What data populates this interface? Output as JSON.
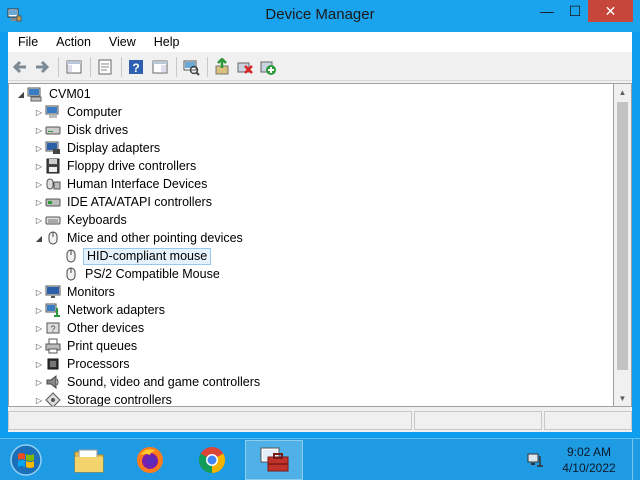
{
  "window": {
    "title": "Device Manager",
    "controls": {
      "minimize": "—",
      "maximize": "☐",
      "close": "✕"
    }
  },
  "menu": [
    "File",
    "Action",
    "View",
    "Help"
  ],
  "toolbar_icons": [
    "back-arrow-icon",
    "forward-arrow-icon",
    "console-tree-icon",
    "properties-icon",
    "help-icon",
    "action-pane-icon",
    "scan-hardware-icon",
    "update-driver-icon",
    "uninstall-device-icon",
    "enable-device-icon"
  ],
  "tree": {
    "root": "CVM01",
    "items": [
      {
        "label": "Computer",
        "icon": "computer-icon",
        "expanded": false
      },
      {
        "label": "Disk drives",
        "icon": "disk-drive-icon",
        "expanded": false
      },
      {
        "label": "Display adapters",
        "icon": "display-adapter-icon",
        "expanded": false
      },
      {
        "label": "Floppy drive controllers",
        "icon": "floppy-controller-icon",
        "expanded": false
      },
      {
        "label": "Human Interface Devices",
        "icon": "hid-icon",
        "expanded": false
      },
      {
        "label": "IDE ATA/ATAPI controllers",
        "icon": "ide-controller-icon",
        "expanded": false
      },
      {
        "label": "Keyboards",
        "icon": "keyboard-icon",
        "expanded": false
      },
      {
        "label": "Mice and other pointing devices",
        "icon": "mouse-icon",
        "expanded": true,
        "children": [
          {
            "label": "HID-compliant mouse",
            "icon": "mouse-icon",
            "selected": true
          },
          {
            "label": "PS/2 Compatible Mouse",
            "icon": "mouse-icon",
            "selected": false
          }
        ]
      },
      {
        "label": "Monitors",
        "icon": "monitor-icon",
        "expanded": false
      },
      {
        "label": "Network adapters",
        "icon": "network-adapter-icon",
        "expanded": false
      },
      {
        "label": "Other devices",
        "icon": "other-devices-icon",
        "expanded": false
      },
      {
        "label": "Print queues",
        "icon": "printer-icon",
        "expanded": false
      },
      {
        "label": "Processors",
        "icon": "processor-icon",
        "expanded": false
      },
      {
        "label": "Sound, video and game controllers",
        "icon": "sound-icon",
        "expanded": false
      },
      {
        "label": "Storage controllers",
        "icon": "storage-controller-icon",
        "expanded": false
      }
    ]
  },
  "taskbar": {
    "pinned": [
      "file-explorer-icon",
      "firefox-icon",
      "chrome-icon",
      "device-manager-icon"
    ],
    "active": "device-manager-icon",
    "time": "9:02 AM",
    "date": "4/10/2022"
  },
  "colors": {
    "titlebar": "#1aa4ee",
    "close": "#c7463c",
    "taskbar": "#1e9be2",
    "selection": "#e5f1fb",
    "selection_border": "#99c9ef"
  }
}
